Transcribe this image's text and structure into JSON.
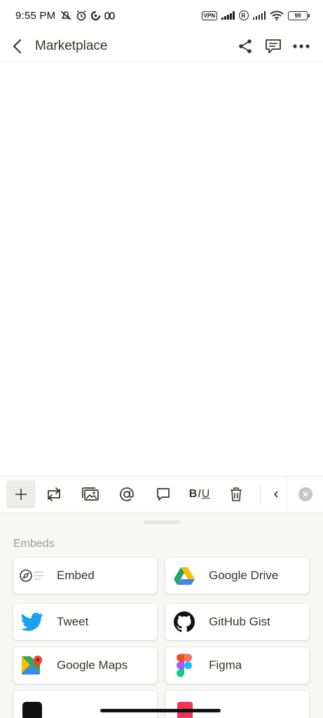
{
  "status_bar": {
    "time": "9:55 PM",
    "vpn": "VPN",
    "r_badge": "R",
    "battery": "99"
  },
  "header": {
    "title": "Marketplace"
  },
  "toolbar": {
    "bold": "B",
    "italic": "I",
    "underline": "U"
  },
  "sheet": {
    "section_label": "Embeds",
    "items": [
      {
        "label": "Embed",
        "icon": "compass-icon"
      },
      {
        "label": "Google Drive",
        "icon": "google-drive-icon"
      },
      {
        "label": "Tweet",
        "icon": "twitter-icon"
      },
      {
        "label": "GitHub Gist",
        "icon": "github-icon"
      },
      {
        "label": "Google Maps",
        "icon": "google-maps-icon"
      },
      {
        "label": "Figma",
        "icon": "figma-icon"
      }
    ]
  },
  "colors": {
    "text": "#37352f",
    "muted": "#9b9a97",
    "sheet_bg": "#f7f7f5",
    "twitter": "#1da1f2"
  }
}
